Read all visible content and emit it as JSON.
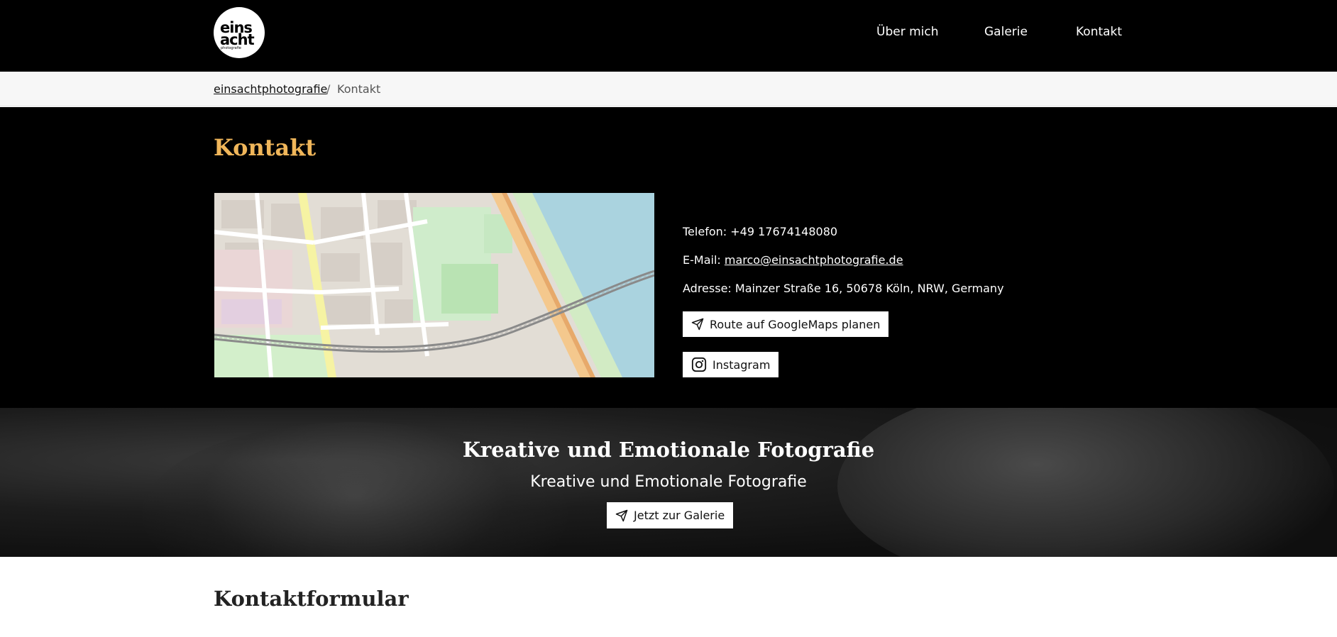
{
  "header": {
    "logo": {
      "line1": "eins",
      "line2": "acht",
      "line3": "photografie"
    },
    "nav": [
      {
        "label": "Über mich"
      },
      {
        "label": "Galerie"
      },
      {
        "label": "Kontakt"
      }
    ]
  },
  "breadcrumb": {
    "home": "einsachtphotografie",
    "separator": "/",
    "current": "Kontakt"
  },
  "contact": {
    "title": "Kontakt",
    "phone_label": "Telefon:",
    "phone": "+49 17674148080",
    "email_label": "E-Mail:",
    "email": "marco@einsachtphotografie.de",
    "address_label": "Adresse:",
    "address": "Mainzer Straße 16, 50678 Köln, NRW, Germany",
    "route_button": "Route auf GoogleMaps planen",
    "instagram_button": "Instagram"
  },
  "banner": {
    "title": "Kreative und Emotionale Fotografie",
    "subtitle": "Kreative und Emotionale Fotografie",
    "button": "Jetzt zur Galerie"
  },
  "form": {
    "title": "Kontaktformular"
  },
  "colors": {
    "accent": "#f0b65a",
    "header_bg": "#000000",
    "button_bg": "#ffffff"
  },
  "icons": {
    "route": "paper-plane-icon",
    "instagram": "instagram-icon",
    "gallery": "paper-plane-icon"
  }
}
